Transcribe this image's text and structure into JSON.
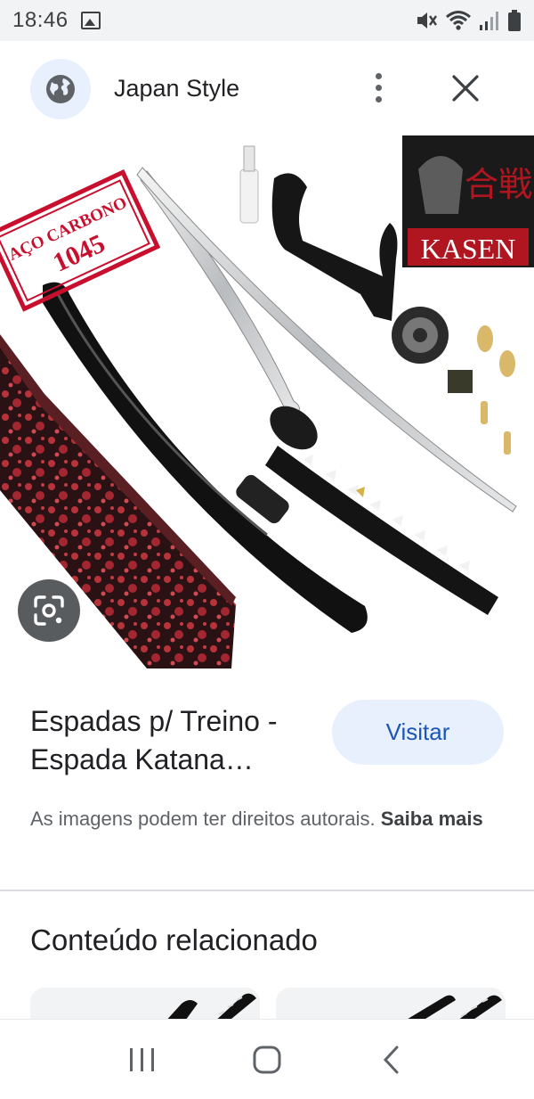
{
  "status_bar": {
    "time": "18:46",
    "icons": [
      "gallery-icon",
      "mute-icon",
      "wifi-icon",
      "signal-icon",
      "battery-icon"
    ]
  },
  "header": {
    "site_icon": "globe-icon",
    "title": "Japan Style",
    "more_icon": "more-vert-icon",
    "close_icon": "close-icon"
  },
  "image": {
    "stamp_line1": "AÇO CARBONO",
    "stamp_line2": "1045",
    "logo_text": "KASEN",
    "logo_kanji": "合戦",
    "lens_icon": "lens-icon"
  },
  "result": {
    "title": "Espadas p/ Treino - Espada Katana…",
    "visit_label": "Visitar",
    "copyright_text": "As imagens podem ter direitos autorais.",
    "learn_more": "Saiba mais"
  },
  "related": {
    "title": "Conteúdo relacionado"
  },
  "nav": {
    "items": [
      "recents-icon",
      "home-icon",
      "back-icon"
    ]
  },
  "colors": {
    "accent": "#1a56b8",
    "button_bg": "#e8f0fe",
    "stamp_red": "#c8102e"
  }
}
